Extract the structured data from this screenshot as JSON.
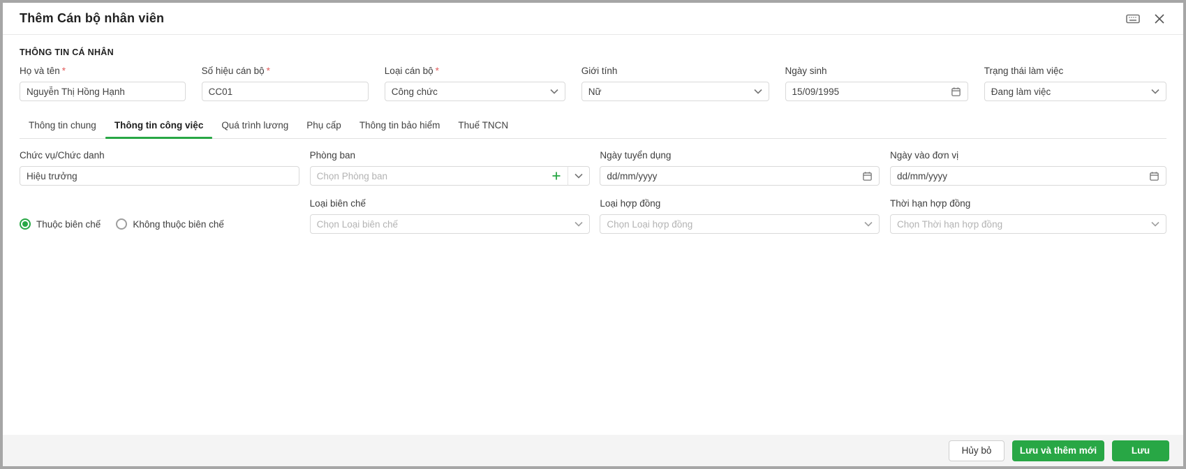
{
  "dialog": {
    "title": "Thêm Cán bộ nhân viên"
  },
  "personal": {
    "section_title": "THÔNG TIN CÁ NHÂN",
    "required_mark": "*",
    "ho_va_ten": {
      "label": "Họ và tên",
      "value": "Nguyễn Thị Hồng Hạnh"
    },
    "so_hieu": {
      "label": "Số hiệu cán bộ",
      "value": "CC01"
    },
    "loai_can_bo": {
      "label": "Loại cán bộ",
      "value": "Công chức"
    },
    "gioi_tinh": {
      "label": "Giới tính",
      "value": "Nữ"
    },
    "ngay_sinh": {
      "label": "Ngày sinh",
      "value": "15/09/1995"
    },
    "trang_thai": {
      "label": "Trạng thái làm việc",
      "value": "Đang làm việc"
    }
  },
  "tabs": [
    {
      "label": "Thông tin chung"
    },
    {
      "label": "Thông tin công việc"
    },
    {
      "label": "Quá trình lương"
    },
    {
      "label": "Phụ cấp"
    },
    {
      "label": "Thông tin bảo hiểm"
    },
    {
      "label": "Thuế TNCN"
    }
  ],
  "work": {
    "chuc_vu": {
      "label": "Chức vụ/Chức danh",
      "value": "Hiệu trưởng"
    },
    "phong_ban": {
      "label": "Phòng ban",
      "placeholder": "Chọn Phòng ban"
    },
    "ngay_tuyen_dung": {
      "label": "Ngày tuyển dụng",
      "placeholder": "dd/mm/yyyy"
    },
    "ngay_vao_don_vi": {
      "label": "Ngày vào đơn vị",
      "placeholder": "dd/mm/yyyy"
    },
    "radio_in_payroll": "Thuộc biên chế",
    "radio_not_in_payroll": "Không thuộc biên chế",
    "loai_bien_che": {
      "label": "Loại biên chế",
      "placeholder": "Chọn Loại biên chế"
    },
    "loai_hop_dong": {
      "label": "Loại hợp đồng",
      "placeholder": "Chọn Loại hợp đồng"
    },
    "thoi_han": {
      "label": "Thời hạn hợp đồng",
      "placeholder": "Chọn Thời hạn hợp đồng"
    }
  },
  "footer": {
    "cancel": "Hủy bỏ",
    "save_and_new": "Lưu và thêm mới",
    "save": "Lưu"
  },
  "colors": {
    "accent_green": "#28a745",
    "required_red": "#e25c5c",
    "footer_bg": "#f4f4f4"
  }
}
